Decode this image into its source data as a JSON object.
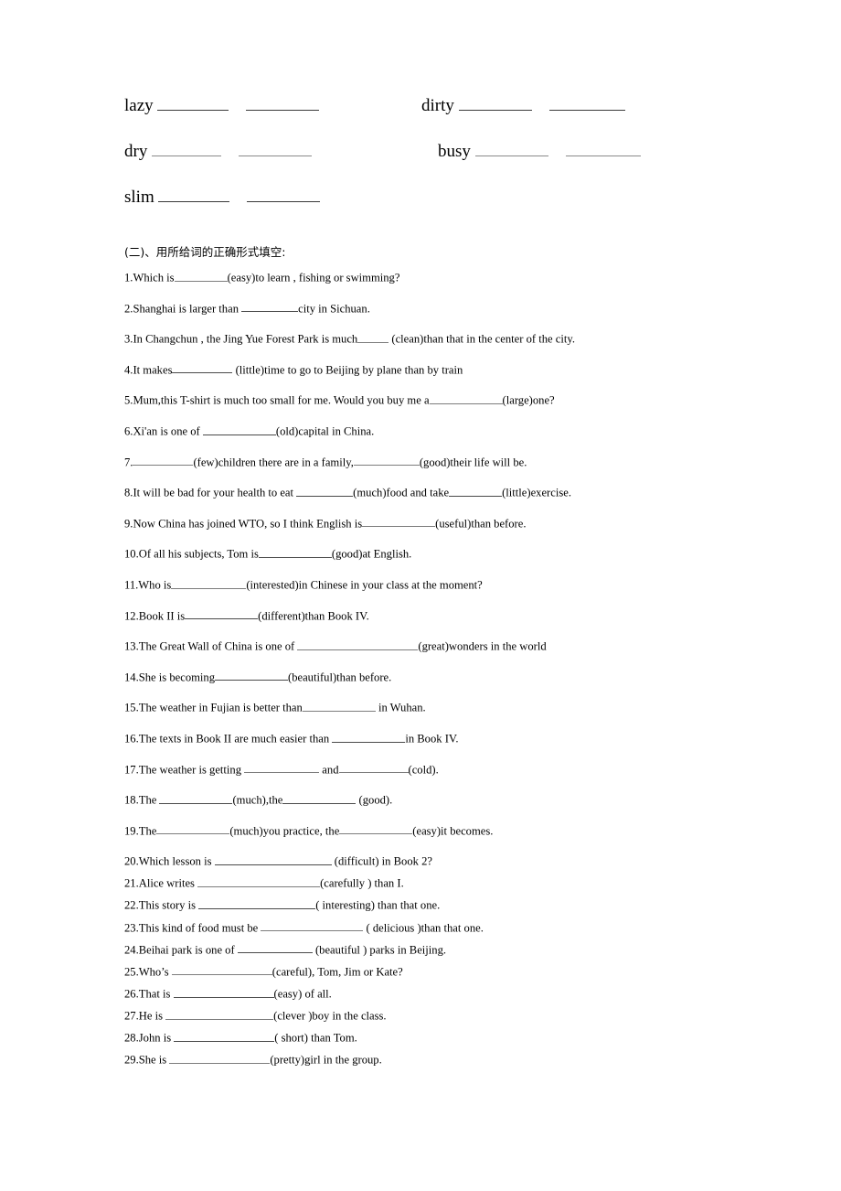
{
  "document": {
    "background_color": "#ffffff",
    "text_color": "#000000"
  },
  "word_list": {
    "rows": [
      {
        "cells": [
          {
            "word": "lazy",
            "blank_widths": [
              78,
              80
            ]
          },
          {
            "word": "dirty",
            "blank_widths": [
              80,
              83
            ]
          }
        ]
      },
      {
        "cells": [
          {
            "word": "dry",
            "blank_widths": [
              76,
              80
            ]
          },
          {
            "word": "busy",
            "blank_widths": [
              80,
              82
            ]
          }
        ]
      },
      {
        "cells": [
          {
            "word": "slim",
            "blank_widths": [
              78,
              80
            ]
          }
        ]
      }
    ]
  },
  "section_heading": "(二)、用所给词的正确形式填空:",
  "questions": [
    {
      "num": "1.",
      "parts": [
        "Which is",
        {
          "blank": 58
        },
        "(easy)to learn , fishing or swimming?"
      ]
    },
    {
      "num": "2.",
      "parts": [
        "Shanghai is larger than ",
        {
          "blank": 62
        },
        "city in Sichuan."
      ]
    },
    {
      "num": "3.",
      "parts": [
        "In Changchun , the Jing Yue Forest Park is much",
        {
          "blank": 34
        },
        " (clean)than that in the center of the city."
      ]
    },
    {
      "num": "4.",
      "parts": [
        "It makes",
        {
          "blank": 66
        },
        " (little)time to go to Beijing by plane than by train"
      ]
    },
    {
      "num": "5.",
      "parts": [
        "Mum,this T-shirt is much too small for me. Would you buy me a",
        {
          "blank": 80
        },
        "(large)one?"
      ]
    },
    {
      "num": "6.",
      "parts": [
        "Xi'an is one of ",
        {
          "blank": 80
        },
        "(old)capital in China."
      ]
    },
    {
      "num": "7.",
      "parts": [
        "",
        {
          "blank": 66
        },
        "(few)children there are in a family,",
        {
          "blank": 72
        },
        "(good)their life will be."
      ]
    },
    {
      "num": "8.",
      "parts": [
        "It will be bad for your health to eat ",
        {
          "blank": 62
        },
        "(much)food and take",
        {
          "blank": 58
        },
        "(little)exercise."
      ]
    },
    {
      "num": "9.",
      "parts": [
        "Now China has joined WTO, so I think English is",
        {
          "blank": 80
        },
        "(useful)than before."
      ]
    },
    {
      "num": "10.",
      "parts": [
        "Of all his subjects, Tom is",
        {
          "blank": 80
        },
        "(good)at English."
      ]
    },
    {
      "num": "11.",
      "parts": [
        "Who is",
        {
          "blank": 82
        },
        "(interested)in Chinese in your class at the moment?"
      ]
    },
    {
      "num": "12.",
      "parts": [
        "Book II is",
        {
          "blank": 80
        },
        "(different)than Book IV."
      ]
    },
    {
      "num": "13.",
      "parts": [
        "The Great Wall of China is one of ",
        {
          "blank": 132
        },
        "(great)wonders in the world"
      ]
    },
    {
      "num": "14.",
      "parts": [
        "She is becoming",
        {
          "blank": 80
        },
        "(beautiful)than before."
      ]
    },
    {
      "num": "15.",
      "parts": [
        "The weather in Fujian is better than",
        {
          "blank": 80
        },
        " in Wuhan."
      ]
    },
    {
      "num": "16.",
      "parts": [
        "The texts in Book II are much easier than ",
        {
          "blank": 80
        },
        "in Book IV."
      ]
    },
    {
      "num": "17.",
      "parts": [
        "The weather is getting ",
        {
          "blank": 82
        },
        " and",
        {
          "blank": 76
        },
        "(cold)."
      ]
    },
    {
      "num": "18.",
      "parts": [
        "The ",
        {
          "blank": 80
        },
        "(much),the",
        {
          "blank": 80
        },
        " (good)."
      ]
    },
    {
      "num": "19.",
      "parts": [
        "The",
        {
          "blank": 80
        },
        "(much)you practice, the",
        {
          "blank": 80
        },
        "(easy)it becomes."
      ]
    },
    {
      "num": "20.",
      "parts": [
        "Which lesson is ",
        {
          "blank": 128
        },
        " (difficult) in Book 2?"
      ]
    },
    {
      "num": "21.",
      "parts": [
        "Alice writes ",
        {
          "blank": 134
        },
        "(carefully ) than I."
      ]
    },
    {
      "num": "22.",
      "parts": [
        "This story is ",
        {
          "blank": 128
        },
        "( interesting) than that one."
      ]
    },
    {
      "num": "23.",
      "parts": [
        "This kind of food must be ",
        {
          "blank": 112
        },
        " ( delicious )than that one."
      ]
    },
    {
      "num": "24.",
      "parts": [
        "Beihai park is one of ",
        {
          "blank": 82
        },
        " (beautiful ) parks in Beijing."
      ]
    },
    {
      "num": "25.",
      "parts": [
        "Who’s ",
        {
          "blank": 110
        },
        "(careful), Tom, Jim or Kate?"
      ]
    },
    {
      "num": "26.",
      "parts": [
        "That is ",
        {
          "blank": 110
        },
        "(easy) of all."
      ]
    },
    {
      "num": "27.",
      "parts": [
        "He is ",
        {
          "blank": 118
        },
        "(clever )boy in the class."
      ]
    },
    {
      "num": "28.",
      "parts": [
        "John is ",
        {
          "blank": 110
        },
        "( short) than Tom."
      ]
    },
    {
      "num": "29.",
      "parts": [
        "She is ",
        {
          "blank": 110
        },
        "(pretty)girl in the group."
      ]
    }
  ]
}
